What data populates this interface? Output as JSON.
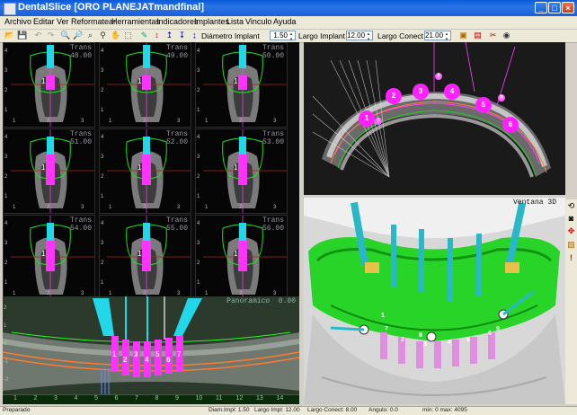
{
  "window": {
    "title": "DentalSlice [ORO PLANEJATmandfinal]"
  },
  "menu": [
    "Archivo",
    "Editar",
    "Ver",
    "Reformatear",
    "Herramientas",
    "Indicadores",
    "Implantes",
    "Lista",
    "Vinculo",
    "Ayuda"
  ],
  "toolbar": {
    "diametro_label": "Diámetro Implant",
    "diametro_value": "1.50",
    "largo_label": "Largo Implant",
    "largo_value": "12.00",
    "conect_label": "Largo Conect",
    "conect_value": "21.00"
  },
  "slices": [
    {
      "label": "Trans",
      "value": "48.00"
    },
    {
      "label": "Trans",
      "value": "49.00"
    },
    {
      "label": "Trans",
      "value": "50.00"
    },
    {
      "label": "Trans",
      "value": "51.00"
    },
    {
      "label": "Trans",
      "value": "52.00"
    },
    {
      "label": "Trans",
      "value": "53.00"
    },
    {
      "label": "Trans",
      "value": "54.00"
    },
    {
      "label": "Trans",
      "value": "55.00"
    },
    {
      "label": "Trans",
      "value": "56.00"
    }
  ],
  "slice_scale": {
    "left": [
      "4",
      "3",
      "2",
      "1"
    ],
    "bottom": [
      "1",
      "2",
      "3"
    ]
  },
  "panoramic": {
    "label": "Panoramico",
    "value": "0.00",
    "axis": [
      "1",
      "2",
      "3",
      "4",
      "5",
      "6",
      "7",
      "8",
      "9",
      "10",
      "11",
      "12",
      "13",
      "14"
    ],
    "left_scale": [
      "2",
      "1",
      "0",
      "-1",
      "-2"
    ]
  },
  "axial_implants": [
    "1",
    "2",
    "3",
    "4",
    "5",
    "6",
    "7",
    "8",
    "9"
  ],
  "view3d": {
    "label": "Ventana 3D",
    "implant_numbers": [
      "1",
      "2",
      "3",
      "4",
      "5",
      "6",
      "7",
      "8",
      "9"
    ]
  },
  "statusbar": {
    "state": "Preparado",
    "diam": "Diam.Impl: 1.50",
    "largo": "Largo Impl: 12.00",
    "conect": "Largo Conect: 8.00",
    "angulo": "Angulo: 0.0",
    "minmax": "min: 0  max: 4095"
  },
  "colors": {
    "title_bar": "#1a5fd6",
    "gingiva_green": "#22cc22",
    "implant_magenta": "#ff33ff",
    "connector_cyan": "#22d8e8",
    "nerve_orange": "#ff8040"
  },
  "icons": [
    "app-icon",
    "minimize-icon",
    "maximize-icon",
    "close-icon",
    "open-folder-icon",
    "save-icon",
    "zoom-in-icon",
    "zoom-out-icon",
    "pan-hand-icon",
    "implant-icon",
    "rotate-icon",
    "binoculars-icon",
    "measure-icon",
    "alert-icon"
  ]
}
